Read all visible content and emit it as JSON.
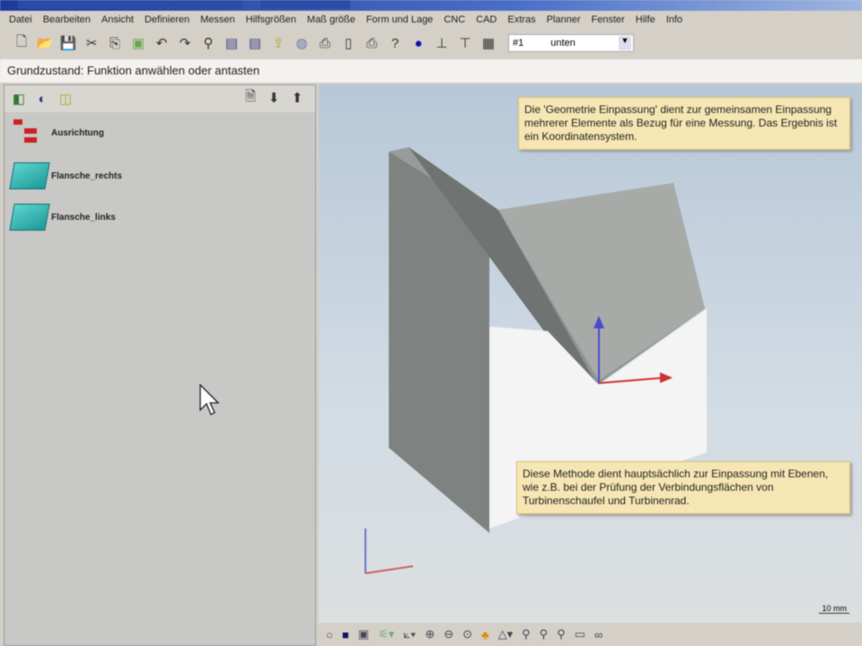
{
  "menu": [
    "Datei",
    "Bearbeiten",
    "Ansicht",
    "Definieren",
    "Messen",
    "Hilfsgrößen",
    "Maß größe",
    "Form und Lage",
    "CNC",
    "CAD",
    "Extras",
    "Planner",
    "Fenster",
    "Hilfe",
    "Info"
  ],
  "toolbar": {
    "combo_prefix": "#1",
    "combo_value": "unten"
  },
  "status": "Grundzustand: Funktion anwählen oder antasten",
  "tree": [
    {
      "label": "Ausrichtung"
    },
    {
      "label": "Flansche_rechts"
    },
    {
      "label": "Flansche_links"
    }
  ],
  "notes": {
    "top": "Die 'Geometrie Einpassung' dient zur gemeinsamen Einpassung mehrerer Elemente als Bezug für eine Messung. Das Ergebnis ist ein Koordinatensystem.",
    "bottom": "Diese Methode dient hauptsächlich zur Einpassung mit Ebenen, wie z.B. bei der Prüfung der Verbindungsflächen von Turbinenschaufel und Turbinenrad."
  },
  "scale_label": "10 mm"
}
